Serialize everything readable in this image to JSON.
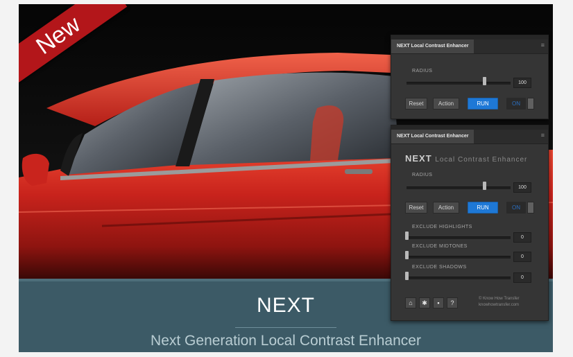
{
  "ribbon": {
    "label": "New",
    "color": "#b3161a"
  },
  "banner": {
    "title": "NEXT",
    "subtitle": "Next Generation Local Contrast Enhancer",
    "background": "#3c5a66"
  },
  "panel_top": {
    "tab_title": "NEXT Local Contrast Enhancer",
    "radius_label": "RADIUS",
    "radius_value": "100",
    "radius_level": 0.73,
    "buttons": {
      "reset": "Reset",
      "action": "Action",
      "run": "RUN",
      "on": "ON"
    }
  },
  "panel_main": {
    "tab_title": "NEXT Local Contrast Enhancer",
    "heading_bold": "NEXT",
    "heading_rest": "Local Contrast Enhancer",
    "radius_label": "RADIUS",
    "radius_value": "100",
    "radius_level": 0.73,
    "buttons": {
      "reset": "Reset",
      "action": "Action",
      "run": "RUN",
      "on": "ON"
    },
    "exclude_highlights_label": "EXCLUDE HIGHLIGHTS",
    "exclude_highlights_value": "0",
    "exclude_midtones_label": "EXCLUDE MIDTONES",
    "exclude_midtones_value": "0",
    "exclude_shadows_label": "EXCLUDE SHADOWS",
    "exclude_shadows_value": "0",
    "footer_icons": [
      "home-icon",
      "gear-icon",
      "document-icon",
      "help-icon"
    ],
    "credit_line1": "© Know How Transfer",
    "credit_line2": "knowhowtransfer.com"
  },
  "colors": {
    "accent": "#1e78d6",
    "panel": "#353535",
    "car": "#c0211c"
  }
}
